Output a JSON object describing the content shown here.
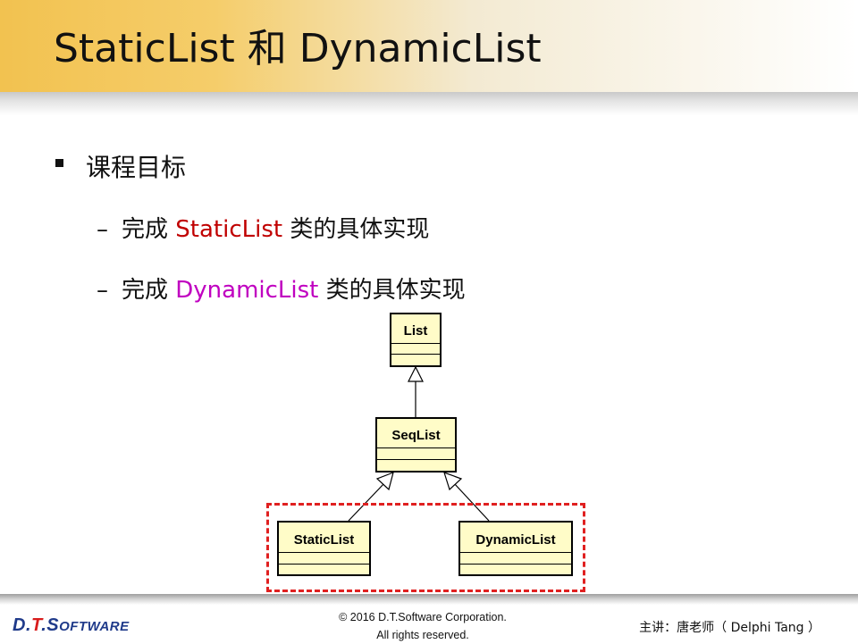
{
  "slide": {
    "title": "StaticList 和 DynamicList",
    "bullet": "课程目标",
    "sub_items": [
      {
        "prefix": "完成 ",
        "highlight": "StaticList",
        "suffix": " 类的具体实现",
        "highlight_color": "#c00000"
      },
      {
        "prefix": "完成 ",
        "highlight": "DynamicList",
        "suffix": " 类的具体实现",
        "highlight_color": "#c000c0"
      }
    ]
  },
  "diagram": {
    "classes": [
      {
        "name": "List"
      },
      {
        "name": "SeqList"
      },
      {
        "name": "StaticList"
      },
      {
        "name": "DynamicList"
      }
    ],
    "highlight_color": "#e02020"
  },
  "footer": {
    "logo": {
      "part1": "D.",
      "part2": "T",
      "part3": ".S",
      "part4": "OFTWARE"
    },
    "copyright_line1": "© 2016 D.T.Software Corporation.",
    "copyright_line2": "All rights reserved.",
    "presenter": "主讲：唐老师（ Delphi Tang ）"
  }
}
